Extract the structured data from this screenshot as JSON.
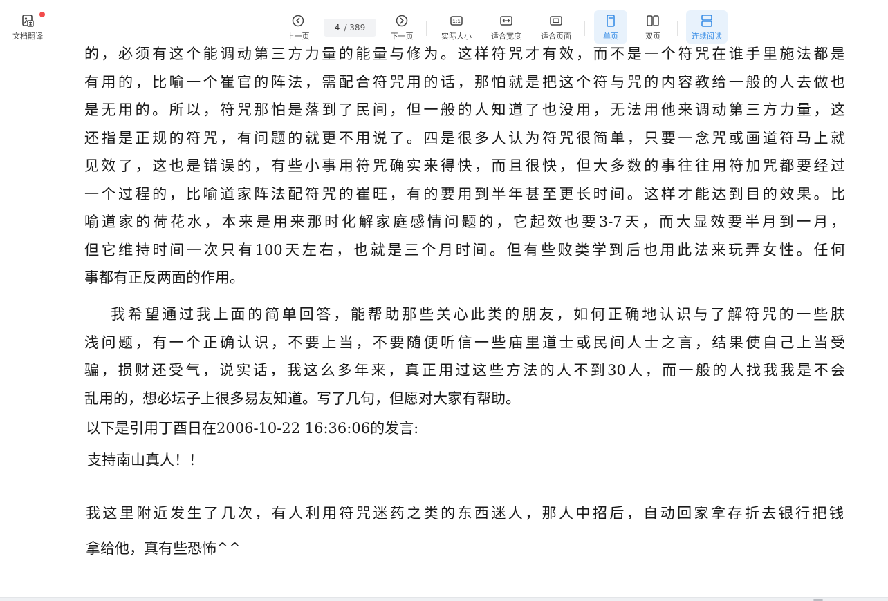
{
  "toolbar": {
    "translate_label": "文档翻译",
    "prev_label": "上一页",
    "page_current": "4",
    "page_total": "/ 389",
    "next_label": "下一页",
    "actual_size_label": "实际大小",
    "actual_size_icon_text": "1:1",
    "fit_width_label": "适合宽度",
    "fit_page_label": "适合页面",
    "single_label": "单页",
    "double_label": "双页",
    "continuous_label": "连续阅读",
    "active_color": "#3a8ee6",
    "active_bg": "#e8f2fc",
    "notification_dot_color": "#f24c4c"
  },
  "document": {
    "para1_lines": [
      "的，必须有这个能调动第三方力量的能量与修为。这样符咒才有效，而不是一个符咒在谁手里施法都是",
      "有用的，比喻一个崔官的阵法，需配合符咒用的话，那怕就是把这个符与咒的内容教给一般的人去做也",
      "是无用的。所以，符咒那怕是落到了民间，但一般的人知道了也没用，无法用他来调动第三方力量，这",
      "还指是正规的符咒，有问题的就更不用说了。四是很多人认为符咒很简单，只要一念咒或画道符马上就",
      "见效了，这也是错误的，有些小事用符咒确实来得快，而且很快，但大多数的事往往用符加咒都要经过",
      "一个过程的，比喻道家阵法配符咒的崔旺，有的要用到半年甚至更长时间。这样才能达到目的效果。比",
      "喻道家的荷花水，本来是用来那时化解家庭感情问题的，它起效也要3-7天，而大显效要半月到一月，",
      "但它维持时间一次只有100天左右，也就是三个月时间。但有些败类学到后也用此法来玩弄女性。任何",
      "事都有正反两面的作用。"
    ],
    "para2_lines": [
      "我希望通过我上面的简单回答，能帮助那些关心此类的朋友，如何正确地认识与了解符咒的一些肤",
      "浅问题，有一个正确认识，不要上当，不要随便听信一些庙里道士或民间人士之言，结果使自己上当受",
      "骗，损财还受气，说实话，我这么多年来，真正用过这些方法的人不到30人，而一般的人找我我是不会",
      "乱用的，想必坛子上很多易友知道。写了几句，但愿对大家有帮助。"
    ],
    "quote_header": "以下是引用丁酉日在2006-10-22 16:36:06的发言:",
    "support_line": "支持南山真人！！",
    "para3_lines": [
      "我这里附近发生了几次，有人利用符咒迷药之类的东西迷人，那人中招后，自动回家拿存折去银行把钱",
      "拿给他，真有些恐怖^^"
    ]
  }
}
